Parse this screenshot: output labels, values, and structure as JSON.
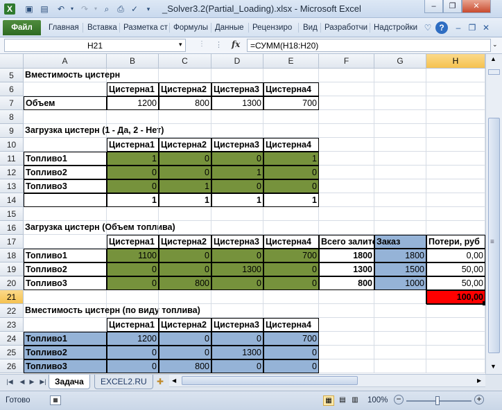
{
  "window": {
    "title": "_Solver3.2(Partial_Loading).xlsx - Microsoft Excel",
    "minimize": "–",
    "restore": "❐",
    "close": "✕"
  },
  "qat": [
    "excel-logo-icon",
    "save-icon",
    "save-as-icon",
    "undo-icon",
    "redo-icon",
    "print-preview-icon",
    "print-icon",
    "spellcheck-icon",
    "customize-icon"
  ],
  "ribbon": {
    "tabs": [
      "Файл",
      "Главная",
      "Вставка",
      "Разметка ст",
      "Формулы",
      "Данные",
      "Рецензиро",
      "Вид",
      "Разработчи",
      "Надстройки"
    ]
  },
  "formula_bar": {
    "name_box": "H21",
    "fx": "fx",
    "formula": "=СУММ(H18:H20)"
  },
  "columns": [
    "A",
    "B",
    "C",
    "D",
    "E",
    "F",
    "G",
    "H"
  ],
  "rows": [
    "5",
    "6",
    "7",
    "8",
    "9",
    "10",
    "11",
    "12",
    "13",
    "14",
    "15",
    "16",
    "17",
    "18",
    "19",
    "20",
    "21",
    "22",
    "23",
    "24",
    "25",
    "26"
  ],
  "cells": {
    "r5": {
      "A": "Вместимость цистерн"
    },
    "r6": {
      "B": "Цистерна1",
      "C": "Цистерна2",
      "D": "Цистерна3",
      "E": "Цистерна4"
    },
    "r7": {
      "A": "Объем",
      "B": "1200",
      "C": "800",
      "D": "1300",
      "E": "700"
    },
    "r9": {
      "A": "Загрузка цистерн (1 - Да, 2 - Нет)"
    },
    "r10": {
      "B": "Цистерна1",
      "C": "Цистерна2",
      "D": "Цистерна3",
      "E": "Цистерна4"
    },
    "r11": {
      "A": "Топливо1",
      "B": "1",
      "C": "0",
      "D": "0",
      "E": "1"
    },
    "r12": {
      "A": "Топливо2",
      "B": "0",
      "C": "0",
      "D": "1",
      "E": "0"
    },
    "r13": {
      "A": "Топливо3",
      "B": "0",
      "C": "1",
      "D": "0",
      "E": "0"
    },
    "r14": {
      "B": "1",
      "C": "1",
      "D": "1",
      "E": "1"
    },
    "r16": {
      "A": "Загрузка цистерн (Объем топлива)"
    },
    "r17": {
      "B": "Цистерна1",
      "C": "Цистерна2",
      "D": "Цистерна3",
      "E": "Цистерна4",
      "F": "Всего залито",
      "G": "Заказ",
      "H": "Потери, руб"
    },
    "r18": {
      "A": "Топливо1",
      "B": "1100",
      "C": "0",
      "D": "0",
      "E": "700",
      "F": "1800",
      "G": "1800",
      "H": "0,00"
    },
    "r19": {
      "A": "Топливо2",
      "B": "0",
      "C": "0",
      "D": "1300",
      "E": "0",
      "F": "1300",
      "G": "1500",
      "H": "50,00"
    },
    "r20": {
      "A": "Топливо3",
      "B": "0",
      "C": "800",
      "D": "0",
      "E": "0",
      "F": "800",
      "G": "1000",
      "H": "50,00"
    },
    "r21": {
      "H": "100,00"
    },
    "r22": {
      "A": "Вместимость цистерн (по виду топлива)"
    },
    "r23": {
      "B": "Цистерна1",
      "C": "Цистерна2",
      "D": "Цистерна3",
      "E": "Цистерна4"
    },
    "r24": {
      "A": "Топливо1",
      "B": "1200",
      "C": "0",
      "D": "0",
      "E": "700"
    },
    "r25": {
      "A": "Топливо2",
      "B": "0",
      "C": "0",
      "D": "1300",
      "E": "0"
    },
    "r26": {
      "A": "Топливо3",
      "B": "0",
      "C": "800",
      "D": "0",
      "E": "0"
    }
  },
  "colors": {
    "green": "#76923c",
    "blue": "#95b3d7",
    "red": "#ff0000"
  },
  "sheets": {
    "tabs": [
      "Задача",
      "EXCEL2.RU"
    ],
    "active": "Задача"
  },
  "status": {
    "ready": "Готово",
    "zoom": "100%"
  }
}
